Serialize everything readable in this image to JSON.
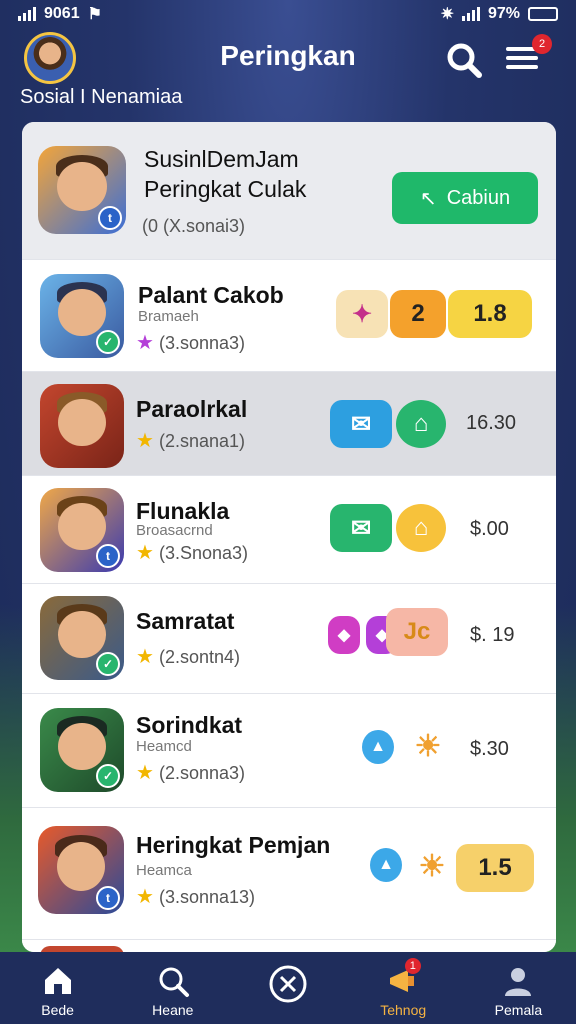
{
  "status_bar": {
    "time": "9061",
    "battery": "97%"
  },
  "header": {
    "title": "Peringkan",
    "subtitle_left": "Sosial",
    "subtitle_right": "Nenamiaa",
    "notification_count": "2"
  },
  "featured": {
    "title_line1": "SusinlDemJam",
    "title_line2": "Peringkat Culak",
    "rating": "(0 (X.sonai3)",
    "action_label": "Cabiun",
    "icon": "hero-app-icon"
  },
  "rows": [
    {
      "title": "Palant Cakob",
      "subtitle": "Bramaeh",
      "rating": "(3.sonna3)",
      "star_color": "#b43fd8",
      "badge": "",
      "chips": [
        {
          "label": "",
          "color": "#f7e2b5",
          "icon": "gem-icon"
        },
        {
          "label": "2",
          "color": "#f4a12c"
        },
        {
          "label": "1.8",
          "color": "#f6d443"
        }
      ],
      "price": ""
    },
    {
      "title": "Paraolrkal",
      "subtitle": "",
      "rating": "(2.snana1)",
      "star_color": "#f2b600",
      "badge": "",
      "chips": [
        {
          "label": "",
          "color": "#2d9fe0",
          "icon": "mail-icon"
        },
        {
          "label": "",
          "color": "#28b56e",
          "icon": "home-icon"
        }
      ],
      "price": "16.30"
    },
    {
      "title": "Flunakla",
      "subtitle": "Broasacrnd",
      "rating": "(3.Snona3)",
      "star_color": "#f2b600",
      "badge": "",
      "chips": [
        {
          "label": "",
          "color": "#28b56e",
          "icon": "mail-icon"
        },
        {
          "label": "",
          "color": "#f7c23b",
          "icon": "home-icon"
        }
      ],
      "price": "$.00"
    },
    {
      "title": "Samratat",
      "subtitle": "",
      "rating": "(2.sontn4)",
      "star_color": "#f2b600",
      "badge": "",
      "chips": [
        {
          "label": "",
          "color": "#d03dc4",
          "icon": "cube-icon"
        },
        {
          "label": "",
          "color": "#b43fd8",
          "icon": "cube-icon"
        },
        {
          "label": "Jc",
          "color": "#f6b7a6"
        }
      ],
      "price": "$. 19"
    },
    {
      "title": "Sorindkat",
      "subtitle": "Heamcd",
      "rating": "(2.sonna3)",
      "star_color": "#f2b600",
      "badge": "",
      "chips": [
        {
          "label": "",
          "color": "#3ca8e8",
          "icon": "ghost-icon"
        },
        {
          "label": "",
          "color": "#f0a030",
          "icon": "mascot-icon"
        }
      ],
      "price": "$.30"
    },
    {
      "title": "Heringkat Pemjan",
      "subtitle": "Heamca",
      "rating": "(3.sonna13)",
      "star_color": "#f2b600",
      "badge": "",
      "chips": [
        {
          "label": "",
          "color": "#3ca8e8",
          "icon": "ghost-icon"
        },
        {
          "label": "",
          "color": "#f0a030",
          "icon": "mascot-icon"
        },
        {
          "label": "1.5",
          "color": "#f6d06a"
        }
      ],
      "price": ""
    }
  ],
  "nav": [
    {
      "label": "Bede",
      "icon": "home-icon"
    },
    {
      "label": "Heane",
      "icon": "search-icon"
    },
    {
      "label": "",
      "icon": "close-circle-icon"
    },
    {
      "label": "Tehnog",
      "icon": "megaphone-icon",
      "badge": "1"
    },
    {
      "label": "Pemala",
      "icon": "person-icon"
    }
  ],
  "colors": {
    "accent": "#1fb86a",
    "nav_bg": "#1f2d5c",
    "active": "#f5b342"
  }
}
